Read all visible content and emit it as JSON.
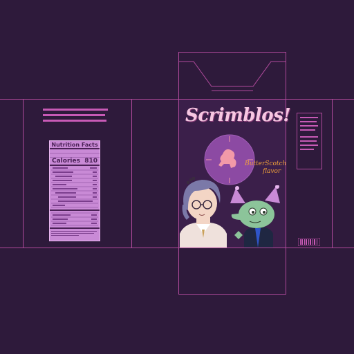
{
  "box": {
    "product_name": "Scrimblos!",
    "flavor_line1": "ButterScotch",
    "flavor_line2": "flavor",
    "nutrition": {
      "title": "Nutrition Facts",
      "calories_label": "Calories",
      "calories_value": "810"
    }
  },
  "colors": {
    "background": "#2e1a3b",
    "fold_lines": "#b04a9c",
    "front_panel": "#3b1f4a",
    "logo": "#f6c7e2",
    "flavor_text": "#f2a23a",
    "nutrition_panel": "#c98ad6",
    "bowl_circle": "#8c4aa3"
  }
}
